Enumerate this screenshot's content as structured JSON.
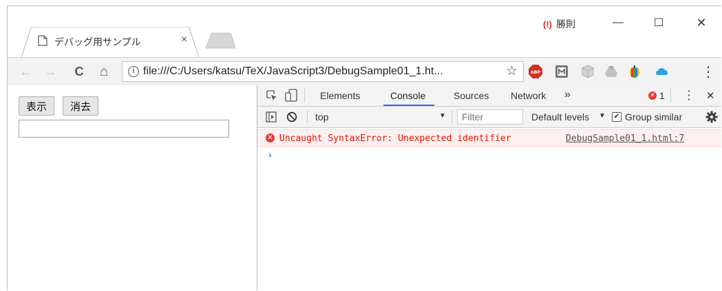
{
  "browser": {
    "tab": {
      "title": "デバッグ用サンプル",
      "close_glyph": "×"
    },
    "extension_warning": {
      "glyph": "(!)",
      "name": "勝則"
    },
    "window_controls": {
      "minimize": "—",
      "maximize": "☐",
      "close": "✕"
    },
    "nav": {
      "back": "←",
      "forward": "→",
      "reload": "C",
      "home": "⌂"
    },
    "omnibox": {
      "info_glyph": "i",
      "url": "file:///C:/Users/katsu/TeX/JavaScript3/DebugSample01_1.ht...",
      "star": "☆"
    },
    "extensions": [
      "abp-icon",
      "m-extension-icon",
      "cube-icon",
      "drive-icon",
      "rainbow-icon",
      "cloud-icon"
    ],
    "menu_glyph": "⋮"
  },
  "page": {
    "buttons": {
      "show": "表示",
      "clear": "消去"
    },
    "input_value": ""
  },
  "devtools": {
    "tabs": [
      "Elements",
      "Console",
      "Sources",
      "Network"
    ],
    "more_glyph": "»",
    "error_count": "1",
    "menu_glyph": "⋮",
    "close_glyph": "✕",
    "filterbar": {
      "context": "top",
      "filter_placeholder": "Filter",
      "levels": "Default levels",
      "dropdown_glyph": "▼",
      "group_similar": "Group similar"
    },
    "console": {
      "error_message": "Uncaught SyntaxError: Unexpected identifier",
      "error_source": "DebugSample01_1.html:7",
      "prompt": "›"
    }
  },
  "colors": {
    "accent_blue": "#1a73e8",
    "error_red": "#e51400",
    "error_bg": "#fff0f0"
  }
}
